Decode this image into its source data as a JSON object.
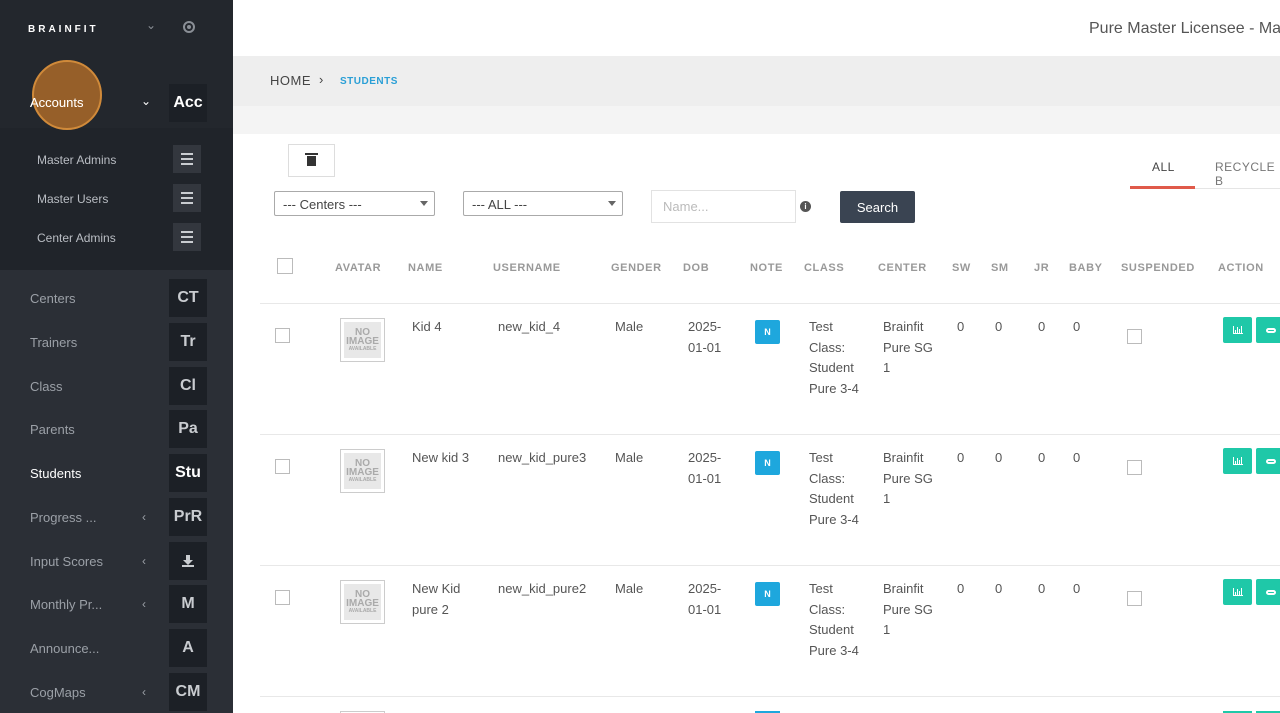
{
  "brand": "BRAINFIT",
  "sidebar": {
    "accounts": {
      "label": "Accounts",
      "tile": "Acc"
    },
    "submenu": [
      {
        "label": "Master Admins"
      },
      {
        "label": "Master Users"
      },
      {
        "label": "Center Admins"
      }
    ],
    "items": [
      {
        "label": "Centers",
        "tile": "CT"
      },
      {
        "label": "Trainers",
        "tile": "Tr"
      },
      {
        "label": "Class",
        "tile": "Cl"
      },
      {
        "label": "Parents",
        "tile": "Pa"
      },
      {
        "label": "Students",
        "tile": "Stu"
      },
      {
        "label": "Progress ...",
        "tile": "PrR"
      },
      {
        "label": "Input Scores",
        "tile": ""
      },
      {
        "label": "Monthly Pr...",
        "tile": "M"
      },
      {
        "label": "Announce...",
        "tile": "A"
      },
      {
        "label": "CogMaps",
        "tile": "CM"
      }
    ]
  },
  "header": {
    "licensee": "Pure Master Licensee - Mas"
  },
  "breadcrumb": {
    "home": "HOME",
    "separator": "›",
    "current": "STUDENTS"
  },
  "tabs": [
    {
      "label": "ALL"
    },
    {
      "label": "RECYCLE B"
    }
  ],
  "filters": {
    "centers": "--- Centers ---",
    "status": "--- ALL ---",
    "name_placeholder": "Name...",
    "info": "i",
    "search_label": "Search"
  },
  "table": {
    "headers": [
      "AVATAR",
      "NAME",
      "USERNAME",
      "GENDER",
      "DOB",
      "NOTE",
      "CLASS",
      "CENTER",
      "SW",
      "SM",
      "JR",
      "BABY",
      "SUSPENDED",
      "ACTION"
    ],
    "avatar_text": {
      "line1": "NO",
      "line2": "IMAGE",
      "line3": "AVAILABLE"
    },
    "rows": [
      {
        "name": "Kid 4",
        "username": "new_kid_4",
        "gender": "Male",
        "dob": "2025-01-01",
        "note": "N",
        "class": "Test Class: Student Pure 3-4",
        "center": "Brainfit Pure SG 1",
        "sw": "0",
        "sm": "0",
        "jr": "0",
        "baby": "0"
      },
      {
        "name": "New kid 3",
        "username": "new_kid_pure3",
        "gender": "Male",
        "dob": "2025-01-01",
        "note": "N",
        "class": "Test Class: Student Pure 3-4",
        "center": "Brainfit Pure SG 1",
        "sw": "0",
        "sm": "0",
        "jr": "0",
        "baby": "0"
      },
      {
        "name": "New Kid pure 2",
        "username": "new_kid_pure2",
        "gender": "Male",
        "dob": "2025-01-01",
        "note": "N",
        "class": "Test Class: Student Pure 3-4",
        "center": "Brainfit Pure SG 1",
        "sw": "0",
        "sm": "0",
        "jr": "0",
        "baby": "0"
      }
    ]
  },
  "colors": {
    "sidebar": "#2b2f36",
    "accent_blue": "#1ea7dd",
    "accent_teal": "#1fc8a8",
    "tab_underline": "#e05a4a",
    "search_button": "#3a4452"
  }
}
